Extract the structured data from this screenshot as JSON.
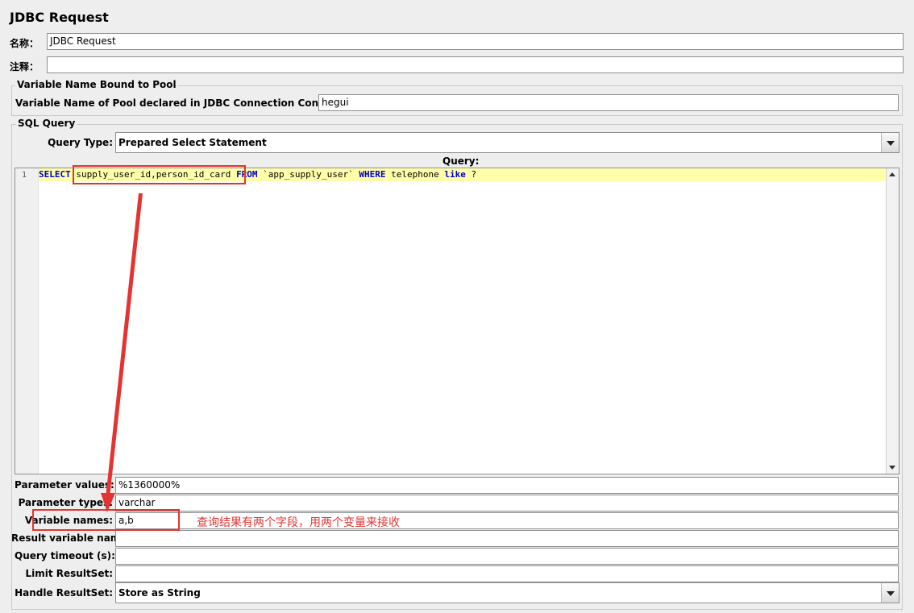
{
  "header": {
    "title": "JDBC Request"
  },
  "name_field": {
    "label": "名称：",
    "value": "JDBC Request"
  },
  "comment_field": {
    "label": "注释：",
    "value": ""
  },
  "pool_section": {
    "legend": "Variable Name Bound to Pool",
    "label": "Variable Name of Pool declared in JDBC Connection Configuration:",
    "value": "hegui"
  },
  "sql_section": {
    "legend": "SQL Query",
    "query_type_label": "Query Type:",
    "query_type_value": "Prepared Select Statement",
    "query_label": "Query:",
    "line_number": "1",
    "query_tokens": [
      {
        "text": "SELECT",
        "kw": true
      },
      {
        "text": " ",
        "kw": false
      },
      {
        "text": "supply_user_id,person_id_card",
        "kw": false
      },
      {
        "text": " ",
        "kw": false
      },
      {
        "text": "FROM",
        "kw": true
      },
      {
        "text": " `app_supply_user` ",
        "kw": false
      },
      {
        "text": "WHERE",
        "kw": true
      },
      {
        "text": " telephone ",
        "kw": false
      },
      {
        "text": "like",
        "kw": true
      },
      {
        "text": " ?",
        "kw": false
      }
    ]
  },
  "params": {
    "parameter_values_label": "Parameter values:",
    "parameter_values": "%1360000%",
    "parameter_types_label": "Parameter types:",
    "parameter_types": "varchar",
    "variable_names_label": "Variable names:",
    "variable_names": "a,b",
    "result_variable_name_label": "Result variable name:",
    "result_variable_name": "",
    "query_timeout_label": "Query timeout (s):",
    "query_timeout": "",
    "limit_resultset_label": "Limit ResultSet:",
    "limit_resultset": "",
    "handle_resultset_label": "Handle ResultSet:",
    "handle_resultset": "Store as String"
  },
  "annotation": {
    "note": "查询结果有两个字段，用两个变量来接收",
    "color": "#e53333"
  }
}
